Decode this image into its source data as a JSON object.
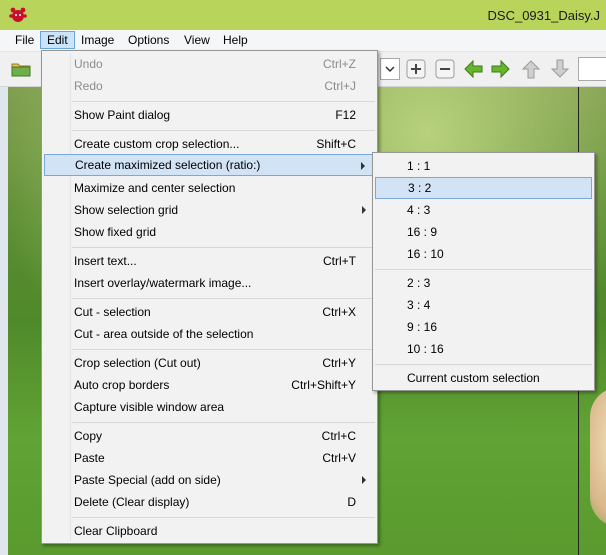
{
  "window": {
    "title": "DSC_0931_Daisy.J",
    "icon": "irfanview-cat-icon"
  },
  "menubar": {
    "items": [
      {
        "label": "File"
      },
      {
        "label": "Edit"
      },
      {
        "label": "Image"
      },
      {
        "label": "Options"
      },
      {
        "label": "View"
      },
      {
        "label": "Help"
      }
    ]
  },
  "toolbar": {
    "icons": [
      "open-folder-icon",
      "dropdown-arrow-icon",
      "zoom-in-icon",
      "zoom-out-icon",
      "previous-arrow-icon",
      "next-arrow-icon",
      "up-arrow-icon",
      "down-arrow-icon"
    ]
  },
  "edit_menu": {
    "items": [
      {
        "label": "Undo",
        "shortcut": "Ctrl+Z",
        "disabled": true
      },
      {
        "label": "Redo",
        "shortcut": "Ctrl+J",
        "disabled": true
      },
      {
        "label": "Show Paint dialog",
        "shortcut": "F12"
      },
      {
        "label": "Create custom crop selection...",
        "shortcut": "Shift+C"
      },
      {
        "label": "Create maximized selection (ratio:)",
        "shortcut": "",
        "submenu": true,
        "highlighted": true
      },
      {
        "label": "Maximize and center selection",
        "shortcut": ""
      },
      {
        "label": "Show selection grid",
        "shortcut": "",
        "submenu": true
      },
      {
        "label": "Show fixed grid",
        "shortcut": ""
      },
      {
        "label": "Insert text...",
        "shortcut": "Ctrl+T"
      },
      {
        "label": "Insert overlay/watermark image...",
        "shortcut": ""
      },
      {
        "label": "Cut - selection",
        "shortcut": "Ctrl+X"
      },
      {
        "label": "Cut - area outside of the selection",
        "shortcut": ""
      },
      {
        "label": "Crop selection (Cut out)",
        "shortcut": "Ctrl+Y"
      },
      {
        "label": "Auto crop borders",
        "shortcut": "Ctrl+Shift+Y"
      },
      {
        "label": "Capture visible window area",
        "shortcut": ""
      },
      {
        "label": "Copy",
        "shortcut": "Ctrl+C"
      },
      {
        "label": "Paste",
        "shortcut": "Ctrl+V"
      },
      {
        "label": "Paste Special (add on side)",
        "shortcut": "",
        "submenu": true
      },
      {
        "label": "Delete (Clear display)",
        "shortcut": "D"
      },
      {
        "label": "Clear Clipboard",
        "shortcut": ""
      }
    ]
  },
  "ratio_submenu": {
    "items": [
      {
        "label": "1 : 1"
      },
      {
        "label": "3 : 2",
        "highlighted": true
      },
      {
        "label": "4 : 3"
      },
      {
        "label": "16 : 9"
      },
      {
        "label": "16 : 10"
      },
      {
        "label": "2 : 3"
      },
      {
        "label": "3 : 4"
      },
      {
        "label": "9 : 16"
      },
      {
        "label": "10 : 16"
      },
      {
        "label": "Current custom selection"
      }
    ]
  }
}
